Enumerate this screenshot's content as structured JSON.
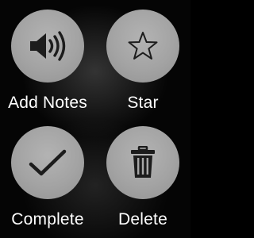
{
  "actions": [
    {
      "id": "add-notes",
      "label": "Add Notes",
      "icon": "speaker-icon"
    },
    {
      "id": "star",
      "label": "Star",
      "icon": "star-icon"
    },
    {
      "id": "complete",
      "label": "Complete",
      "icon": "checkmark-icon"
    },
    {
      "id": "delete",
      "label": "Delete",
      "icon": "trash-icon"
    }
  ],
  "colors": {
    "background": "#000000",
    "button_fill": "#a8a8a8",
    "icon": "#1c1c1c",
    "label": "#ffffff"
  }
}
